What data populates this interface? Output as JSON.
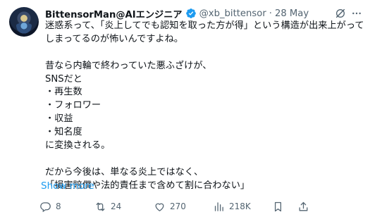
{
  "author": {
    "name": "BittensorMan@AIエンジニア",
    "handle": "@xb_bittensor",
    "separator": "·",
    "date": "28 May"
  },
  "icons": {
    "verified_color": "#1d9bf0",
    "grok": "grok-icon",
    "more": "more-options-icon"
  },
  "body": {
    "lines": [
      "迷惑系って、「炎上してでも認知を取った方が得」という構造が出来上がって",
      "しまってるのが怖いんですよね。",
      "",
      "昔なら内輪で終わっていた悪ふざけが、",
      "SNSだと",
      "・再生数",
      "・フォロワー",
      "・収益",
      "・知名度",
      "に変換される。",
      "",
      "だから今後は、単なる炎上ではなく、",
      "「損害賠償や法的責任まで含めて割に合わない」"
    ]
  },
  "show_more": "Show more",
  "metrics": {
    "replies": "8",
    "reposts": "24",
    "likes": "270",
    "views": "218K"
  },
  "colors": {
    "text": "#0f1419",
    "muted": "#536471",
    "link": "#1d9bf0"
  }
}
